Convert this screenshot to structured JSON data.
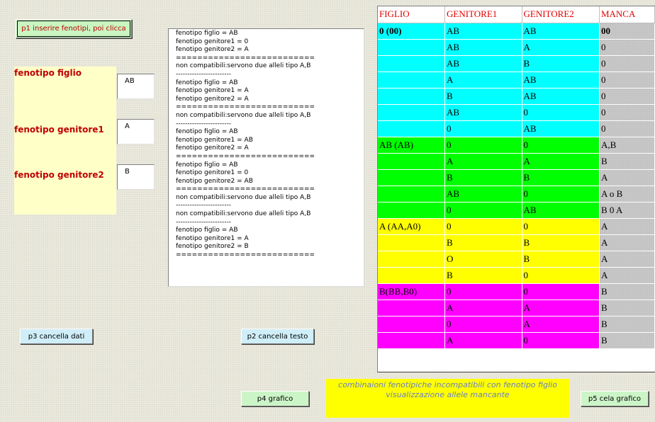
{
  "buttons": {
    "p1": "p1 inserire fenotipi, poi clicca",
    "p2": "p2 cancella testo",
    "p3": "p3 cancella dati",
    "p4": "p4 grafico",
    "p5": "p5 cela grafico"
  },
  "inputs": {
    "figlio_label": "fenotipo figlio",
    "figlio_value": "AB",
    "genitore1_label": "fenotipo genitore1",
    "genitore1_value": "A",
    "genitore2_label": "fenotipo genitore2",
    "genitore2_value": "B"
  },
  "text_output": [
    "fenotipo figlio = AB",
    "fenotipo genitore1 = 0",
    "fenotipo genitore2 = A",
    "==========================",
    "non compatibili:servono due alleli tipo A,B",
    "------------------------",
    "fenotipo figlio = AB",
    "fenotipo genitore1 = A",
    "fenotipo genitore2 = A",
    "==========================",
    "non compatibili:servono due alleli tipo A,B",
    "------------------------",
    "fenotipo figlio = AB",
    "fenotipo genitore1 = AB",
    "fenotipo genitore2 = A",
    "==========================",
    "fenotipo figlio = AB",
    "fenotipo genitore1 = 0",
    "fenotipo genitore2 = AB",
    "==========================",
    "non compatibili:servono due alleli tipo A,B",
    "------------------------",
    "non compatibili:servono due alleli tipo A,B",
    "------------------------",
    "fenotipo figlio = AB",
    "fenotipo genitore1 = A",
    "fenotipo genitore2 = B",
    "=========================="
  ],
  "table": {
    "headers": [
      "FIGLIO",
      "GENITORE1",
      "GENITORE2",
      "MANCA"
    ],
    "groups": [
      {
        "color": "cyan",
        "rows": [
          [
            "0 (00)",
            "AB",
            "AB",
            "00"
          ],
          [
            "",
            "AB",
            "A",
            "0"
          ],
          [
            "",
            "AB",
            "B",
            "0"
          ],
          [
            "",
            "A",
            "AB",
            "0"
          ],
          [
            "",
            "B",
            "AB",
            "0"
          ],
          [
            "",
            "AB",
            "0",
            "0"
          ],
          [
            "",
            "0",
            "AB",
            "0"
          ]
        ]
      },
      {
        "color": "green",
        "rows": [
          [
            "AB (AB)",
            "0",
            "0",
            "A,B"
          ],
          [
            "",
            "A",
            "A",
            "B"
          ],
          [
            "",
            "B",
            "B",
            "A"
          ],
          [
            "",
            "AB",
            "0",
            "A o B"
          ],
          [
            "",
            "0",
            "AB",
            "B 0 A"
          ]
        ]
      },
      {
        "color": "yellow",
        "rows": [
          [
            "A (AA,A0)",
            "0",
            "0",
            "A"
          ],
          [
            "",
            "B",
            "B",
            "A"
          ],
          [
            "",
            "O",
            "B",
            "A"
          ],
          [
            "",
            "B",
            "0",
            "A"
          ]
        ]
      },
      {
        "color": "magenta",
        "rows": [
          [
            "B(BB,B0)",
            "0",
            "0",
            "B"
          ],
          [
            "",
            "A",
            "A",
            "B"
          ],
          [
            "",
            "0",
            "A",
            "B"
          ],
          [
            "",
            "A",
            "0",
            "B"
          ]
        ]
      }
    ]
  },
  "note": {
    "line1": "combinaioni fenotipiche incompatibili con fenotipo figlio",
    "line2": "visualizzazione allele mancante"
  },
  "colors": {
    "cyan": "#00ffff",
    "green": "#00ff00",
    "yellow": "#ffff00",
    "magenta": "#ff00ff",
    "header_text": "#e00000",
    "label_text": "#c00000"
  }
}
